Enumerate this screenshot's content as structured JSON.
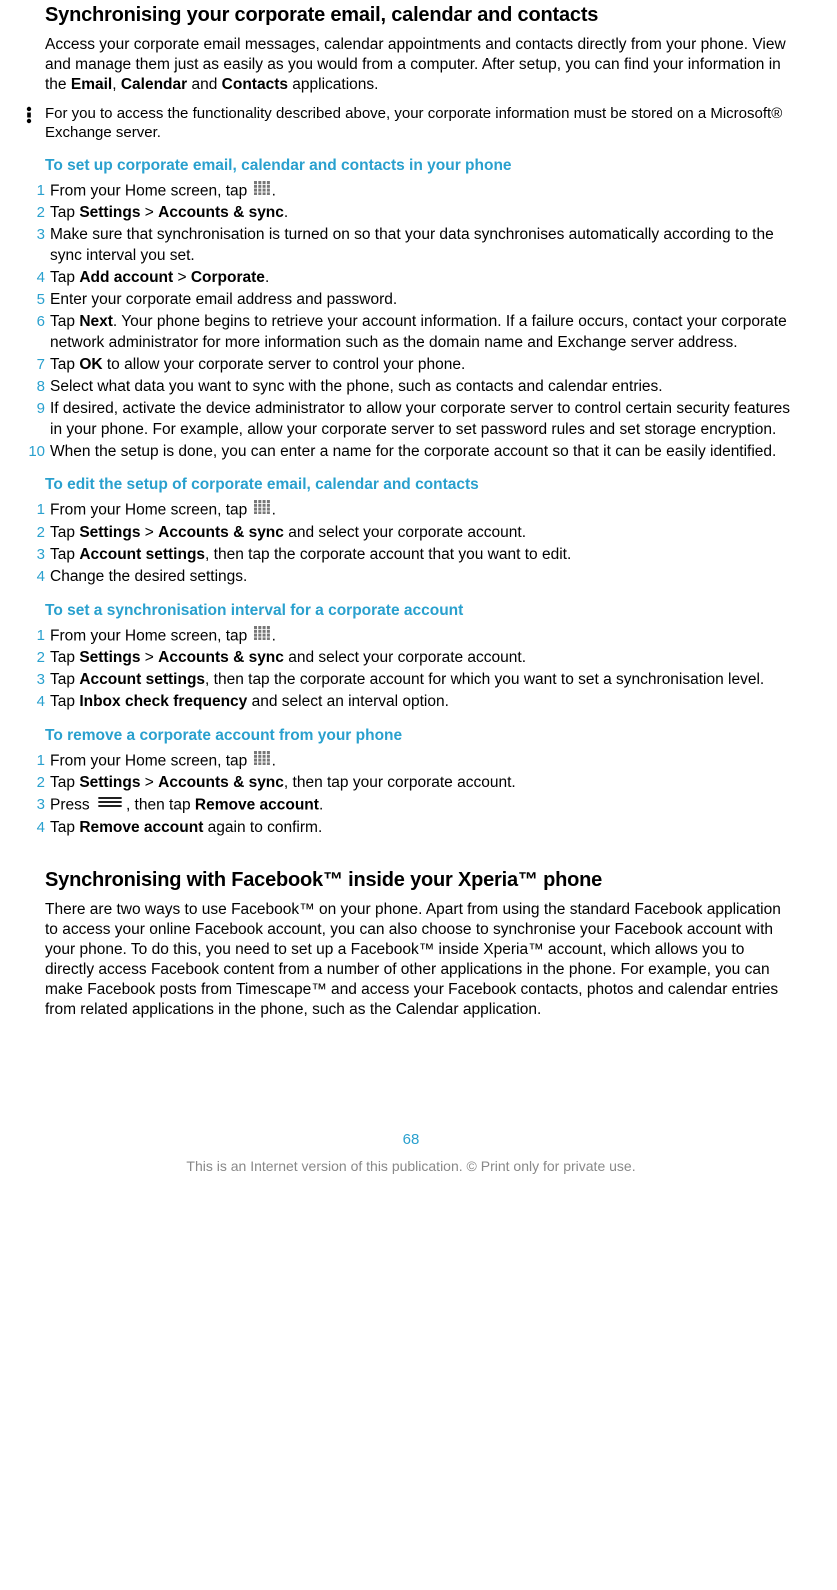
{
  "title1": "Synchronising your corporate email, calendar and contacts",
  "intro1_parts": [
    "Access your corporate email messages, calendar appointments and contacts directly from your phone. View and manage them just as easily as you would from a computer. After setup, you can find your information in the ",
    "Email",
    ", ",
    "Calendar",
    " and ",
    "Contacts",
    " applications."
  ],
  "note1": "For you to access the functionality described above, your corporate information must be stored on a Microsoft® Exchange server.",
  "sectionA": {
    "heading": "To set up corporate email, calendar and contacts in your phone",
    "steps": [
      {
        "n": "1",
        "t": [
          "From your Home screen, tap ",
          "[GRID]",
          "."
        ]
      },
      {
        "n": "2",
        "t": [
          "Tap ",
          "<b>Settings</b>",
          " > ",
          "<b>Accounts & sync</b>",
          "."
        ]
      },
      {
        "n": "3",
        "t": [
          "Make sure that synchronisation is turned on so that your data synchronises automatically according to the sync interval you set."
        ]
      },
      {
        "n": "4",
        "t": [
          "Tap ",
          "<b>Add account</b>",
          " > ",
          "<b>Corporate</b>",
          "."
        ]
      },
      {
        "n": "5",
        "t": [
          "Enter your corporate email address and password."
        ]
      },
      {
        "n": "6",
        "t": [
          "Tap ",
          "<b>Next</b>",
          ". Your phone begins to retrieve your account information. If a failure occurs, contact your corporate network administrator for more information such as the domain name and Exchange server address."
        ]
      },
      {
        "n": "7",
        "t": [
          "Tap ",
          "<b>OK</b>",
          " to allow your corporate server to control your phone."
        ]
      },
      {
        "n": "8",
        "t": [
          "Select what data you want to sync with the phone, such as contacts and calendar entries."
        ]
      },
      {
        "n": "9",
        "t": [
          "If desired, activate the device administrator to allow your corporate server to control certain security features in your phone. For example, allow your corporate server to set password rules and set storage encryption."
        ]
      },
      {
        "n": "10",
        "t": [
          "When the setup is done, you can enter a name for the corporate account so that it can be easily identified."
        ]
      }
    ]
  },
  "sectionB": {
    "heading": "To edit the setup of corporate email, calendar and contacts",
    "steps": [
      {
        "n": "1",
        "t": [
          "From your Home screen, tap ",
          "[GRID]",
          "."
        ]
      },
      {
        "n": "2",
        "t": [
          "Tap ",
          "<b>Settings</b>",
          " > ",
          "<b>Accounts & sync</b>",
          " and select your corporate account."
        ]
      },
      {
        "n": "3",
        "t": [
          "Tap ",
          "<b>Account settings</b>",
          ", then tap the corporate account that you want to edit."
        ]
      },
      {
        "n": "4",
        "t": [
          "Change the desired settings."
        ]
      }
    ]
  },
  "sectionC": {
    "heading": "To set a synchronisation interval for a corporate account",
    "steps": [
      {
        "n": "1",
        "t": [
          "From your Home screen, tap ",
          "[GRID]",
          "."
        ]
      },
      {
        "n": "2",
        "t": [
          "Tap ",
          "<b>Settings</b>",
          " > ",
          "<b>Accounts & sync</b>",
          " and select your corporate account."
        ]
      },
      {
        "n": "3",
        "t": [
          "Tap ",
          "<b>Account settings</b>",
          ", then tap the corporate account for which you want to set a synchronisation level."
        ]
      },
      {
        "n": "4",
        "t": [
          "Tap ",
          "<b>Inbox check frequency</b>",
          " and select an interval option."
        ]
      }
    ]
  },
  "sectionD": {
    "heading": "To remove a corporate account from your phone",
    "steps": [
      {
        "n": "1",
        "t": [
          "From your Home screen, tap ",
          "[GRID]",
          "."
        ]
      },
      {
        "n": "2",
        "t": [
          "Tap ",
          "<b>Settings</b>",
          " > ",
          "<b>Accounts & sync</b>",
          ", then tap your corporate account."
        ]
      },
      {
        "n": "3",
        "t": [
          "Press ",
          "[MENU]",
          ", then tap ",
          "<b>Remove account</b>",
          "."
        ]
      },
      {
        "n": "4",
        "t": [
          "Tap ",
          "<b>Remove account</b>",
          " again to confirm."
        ]
      }
    ]
  },
  "title2": "Synchronising with Facebook™ inside your Xperia™ phone",
  "intro2": "There are two ways to use Facebook™ on your phone. Apart from using the standard Facebook application to access your online Facebook account, you can also choose to synchronise your Facebook account with your phone. To do this, you need to set up a Facebook™ inside Xperia™ account, which allows you to directly access Facebook content from a number of other applications in the phone. For example, you can make Facebook posts from Timescape™ and access your Facebook contacts, photos and calendar entries from related applications in the phone, such as the Calendar application.",
  "page_number": "68",
  "footer_note": "This is an Internet version of this publication. © Print only for private use."
}
